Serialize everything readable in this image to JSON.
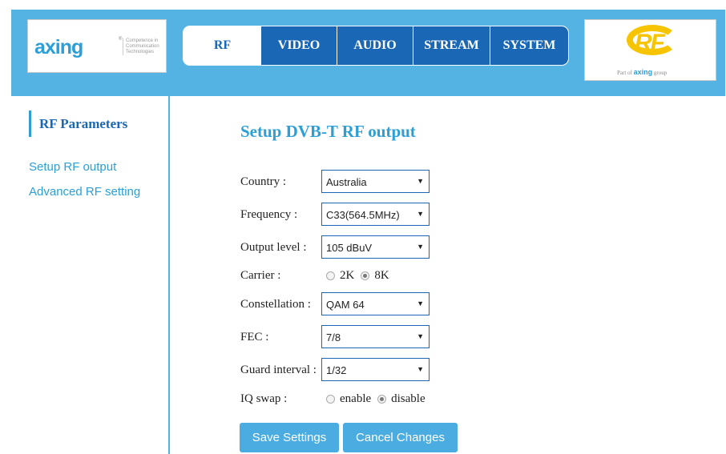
{
  "brand": {
    "logo_word": "axing",
    "logo_reg": "®",
    "logo_tagline": "Competence in Communication Technologies",
    "partner_logo": "RF",
    "partner_tag_prefix": "Part of",
    "partner_tag_brand": "axing",
    "partner_tag_suffix": "group"
  },
  "nav": {
    "tabs": [
      {
        "label": "RF",
        "active": true
      },
      {
        "label": "VIDEO",
        "active": false
      },
      {
        "label": "AUDIO",
        "active": false
      },
      {
        "label": "STREAM",
        "active": false
      },
      {
        "label": "SYSTEM",
        "active": false
      }
    ]
  },
  "sidebar": {
    "title": "RF Parameters",
    "links": [
      "Setup RF output",
      "Advanced RF setting"
    ]
  },
  "main": {
    "title": "Setup DVB-T RF output",
    "country": {
      "label": "Country :",
      "value": "Australia"
    },
    "frequency": {
      "label": "Frequency :",
      "value": "C33(564.5MHz)"
    },
    "output_level": {
      "label": "Output level :",
      "value": "105 dBuV"
    },
    "carrier": {
      "label": "Carrier :",
      "options": [
        "2K",
        "8K"
      ],
      "selected": "8K"
    },
    "constellation": {
      "label": "Constellation :",
      "value": "QAM 64"
    },
    "fec": {
      "label": "FEC :",
      "value": "7/8"
    },
    "guard_interval": {
      "label": "Guard interval :",
      "value": "1/32"
    },
    "iq_swap": {
      "label": "IQ swap :",
      "options": [
        "enable",
        "disable"
      ],
      "selected": "disable"
    },
    "save_label": "Save Settings",
    "cancel_label": "Cancel Changes"
  },
  "colors": {
    "header_bg": "#55b3e3",
    "nav_tab_bg": "#1a67b5",
    "accent": "#2a9fd8",
    "button_bg": "#4aace0",
    "partner_yellow": "#f6c400"
  }
}
